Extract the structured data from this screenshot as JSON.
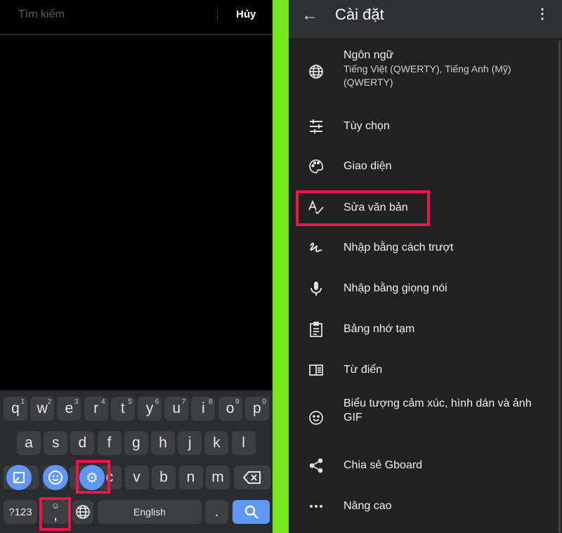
{
  "search": {
    "placeholder": "Tìm kiếm",
    "cancel_label": "Hủy"
  },
  "keyboard": {
    "row1": [
      {
        "k": "q",
        "h": "1"
      },
      {
        "k": "w",
        "h": "2"
      },
      {
        "k": "e",
        "h": "3"
      },
      {
        "k": "r",
        "h": "4"
      },
      {
        "k": "t",
        "h": "5"
      },
      {
        "k": "y",
        "h": "6"
      },
      {
        "k": "u",
        "h": "7"
      },
      {
        "k": "i",
        "h": "8"
      },
      {
        "k": "o",
        "h": "9"
      },
      {
        "k": "p",
        "h": "0"
      }
    ],
    "row2": [
      "a",
      "s",
      "d",
      "f",
      "g",
      "h",
      "j",
      "k",
      "l"
    ],
    "row3": [
      "c",
      "v",
      "b",
      "n",
      "m"
    ],
    "symbols_label": "?123",
    "comma_label": ",",
    "space_label": "English",
    "period_label": ".",
    "accent_color": "#5e97f6",
    "highlight_color": "#f0134d"
  },
  "settings": {
    "title": "Cài đặt",
    "items": [
      {
        "icon": "globe-icon",
        "label": "Ngôn ngữ",
        "sub": "Tiếng Việt (QWERTY), Tiếng Anh (Mỹ) (QWERTY)"
      },
      {
        "icon": "sliders-icon",
        "label": "Tùy chọn"
      },
      {
        "icon": "palette-icon",
        "label": "Giao diện"
      },
      {
        "icon": "spellcheck-icon",
        "label": "Sửa văn bản"
      },
      {
        "icon": "gesture-icon",
        "label": "Nhập bằng cách trượt"
      },
      {
        "icon": "mic-icon",
        "label": "Nhập bằng giọng nói"
      },
      {
        "icon": "clipboard-icon",
        "label": "Bảng nhớ tạm"
      },
      {
        "icon": "dictionary-icon",
        "label": "Từ điển"
      },
      {
        "icon": "emoji-icon",
        "label": "Biểu tượng cảm xúc, hình dán và ảnh GIF"
      },
      {
        "icon": "share-icon",
        "label": "Chia sẻ Gboard"
      },
      {
        "icon": "more-horiz-icon",
        "label": "Nâng cao"
      }
    ]
  }
}
